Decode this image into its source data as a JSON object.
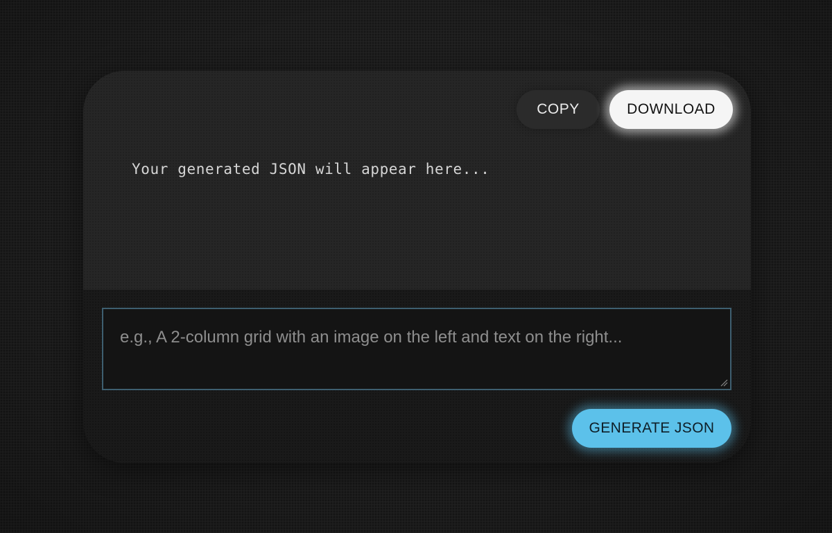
{
  "toolbar": {
    "copy_label": "COPY",
    "download_label": "DOWNLOAD"
  },
  "output": {
    "placeholder_text": "Your generated JSON will appear here..."
  },
  "prompt": {
    "placeholder": "e.g., A 2-column grid with an image on the left and text on the right...",
    "value": ""
  },
  "actions": {
    "generate_label": "GENERATE JSON"
  },
  "colors": {
    "accent": "#5cc1ea",
    "download_bg": "#f5f5f5",
    "input_border": "#3e5f70",
    "background": "#1d1d1d"
  },
  "icons": {
    "resize": "resize-handle-icon"
  }
}
